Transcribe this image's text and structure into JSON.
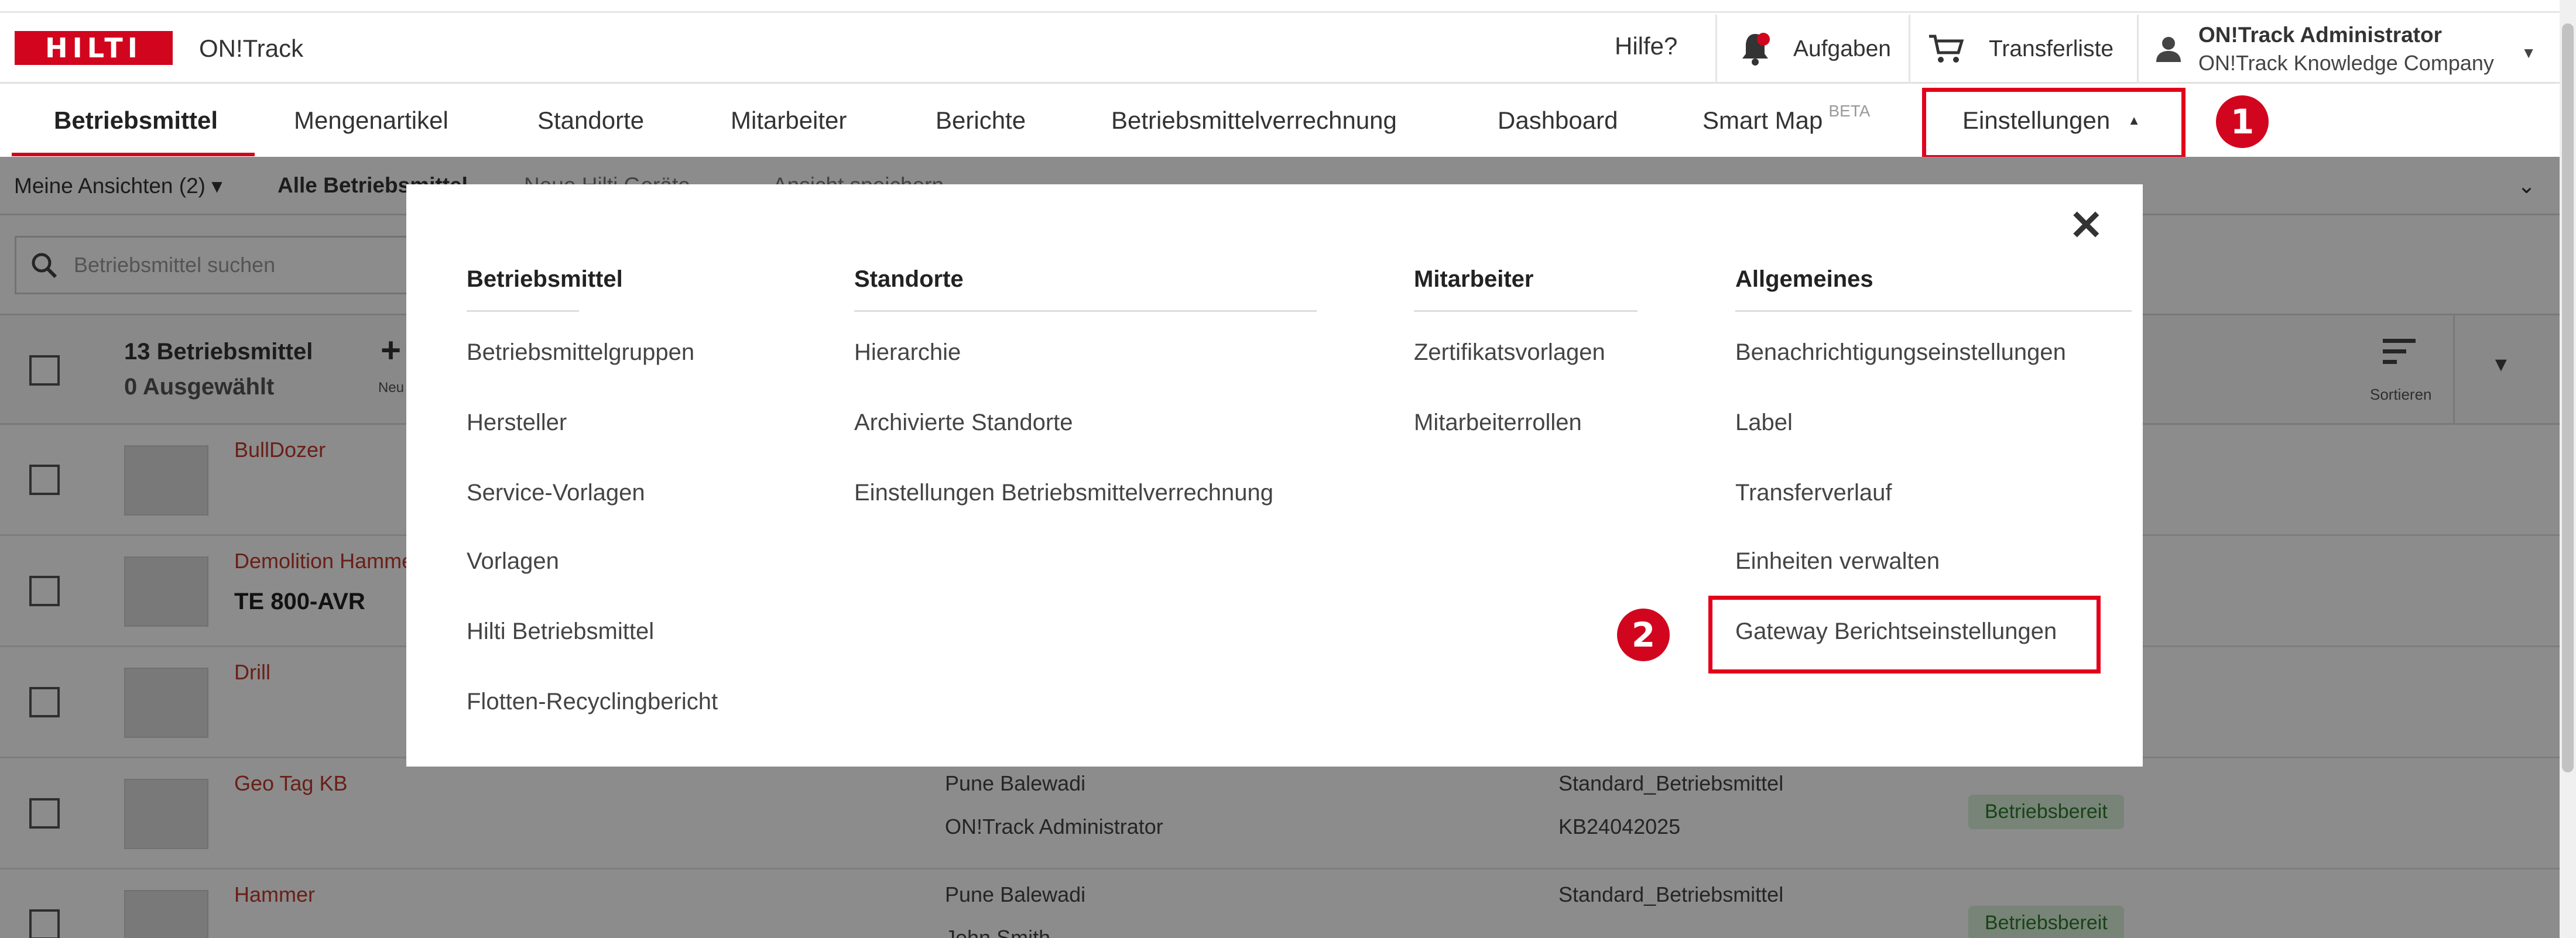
{
  "header": {
    "brand": "HILTI",
    "app_name": "ON!Track",
    "help": "Hilfe?",
    "tasks": "Aufgaben",
    "transfer_list": "Transferliste",
    "user_name": "ON!Track Administrator",
    "user_company": "ON!Track Knowledge Company"
  },
  "nav": {
    "items": [
      "Betriebsmittel",
      "Mengenartikel",
      "Standorte",
      "Mitarbeiter",
      "Berichte",
      "Betriebsmittelverrechnung",
      "Dashboard",
      "Smart Map",
      "Einstellungen"
    ],
    "beta": "BETA"
  },
  "callouts": [
    "1",
    "2"
  ],
  "page": {
    "views": "Meine Ansichten (2)",
    "all_assets": "Alle Betriebsmittel",
    "new_hilti": "Neue Hilti Geräte",
    "save_view": "Ansicht speichern",
    "search_placeholder": "Betriebsmittel suchen",
    "count": "13 Betriebsmittel",
    "selected": "0 Ausgewählt",
    "new_label": "Neu",
    "sort": "Sortieren",
    "rows": [
      {
        "name": "BullDozer",
        "sub": "",
        "location": "",
        "owner": "",
        "template": "",
        "code": "",
        "status": ""
      },
      {
        "name": "Demolition Hammer",
        "sub": "TE 800-AVR",
        "location": "",
        "owner": "",
        "template": "",
        "code": "",
        "status": ""
      },
      {
        "name": "Drill",
        "sub": "",
        "location": "",
        "owner": "",
        "template": "",
        "code": "",
        "status": ""
      },
      {
        "name": "Geo Tag KB",
        "sub": "",
        "location": "Pune Balewadi",
        "owner": "ON!Track Administrator",
        "template": "Standard_Betriebsmittel",
        "code": "KB24042025",
        "status": "Betriebsbereit"
      },
      {
        "name": "Hammer",
        "sub": "",
        "location": "Pune Balewadi",
        "owner": "John Smith",
        "template": "Standard_Betriebsmittel",
        "code": "",
        "status": "Betriebsbereit"
      }
    ]
  },
  "menu": {
    "close": "✕",
    "columns": [
      {
        "title": "Betriebsmittel",
        "links": [
          "Betriebsmittelgruppen",
          "Hersteller",
          "Service-Vorlagen",
          "Vorlagen",
          "Hilti Betriebsmittel",
          "Flotten-Recyclingbericht"
        ]
      },
      {
        "title": "Standorte",
        "links": [
          "Hierarchie",
          "Archivierte Standorte",
          "Einstellungen Betriebsmittelverrechnung"
        ]
      },
      {
        "title": "Mitarbeiter",
        "links": [
          "Zertifikatsvorlagen",
          "Mitarbeiterrollen"
        ]
      },
      {
        "title": "Allgemeines",
        "links": [
          "Benachrichtigungseinstellungen",
          "Label",
          "Transferverlauf",
          "Einheiten verwalten",
          "Gateway Berichtseinstellungen"
        ]
      }
    ]
  }
}
